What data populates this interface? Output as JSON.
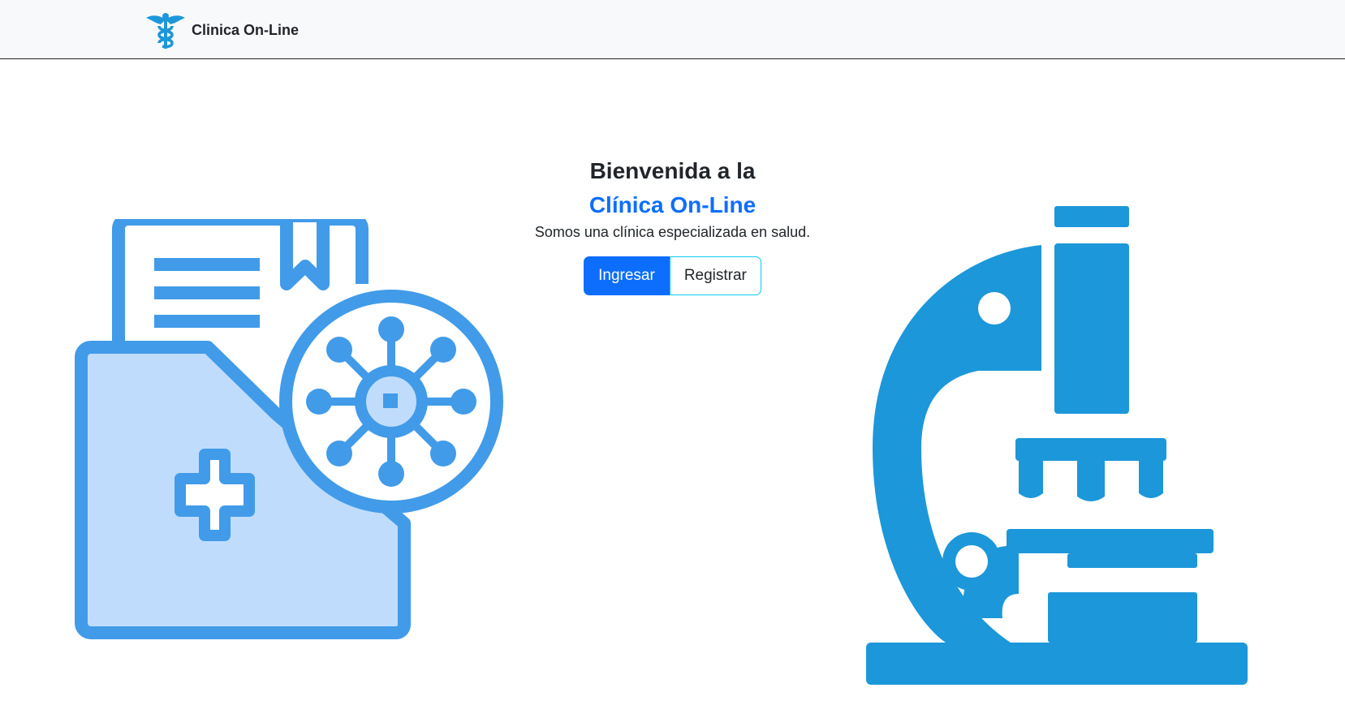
{
  "navbar": {
    "brand_text": "Clinica On-Line",
    "logo_icon": "caduceus-icon",
    "background": "#f8f9fa"
  },
  "hero": {
    "title_line1": "Bienvenida a la",
    "title_line2": "Clínica On-Line",
    "subtitle": "Somos una clínica especializada en salud.",
    "buttons": {
      "login_label": "Ingresar",
      "register_label": "Registrar"
    }
  },
  "illustrations": {
    "left": "medical-folder-virus-icon",
    "right": "microscope-icon"
  },
  "colors": {
    "accent": "#0d6efd",
    "outline": "#0dcaf0",
    "illustration_blue": "#419be8",
    "illustration_light": "#bfdcfc",
    "microscope_blue": "#1c97d9",
    "text": "#212529"
  }
}
